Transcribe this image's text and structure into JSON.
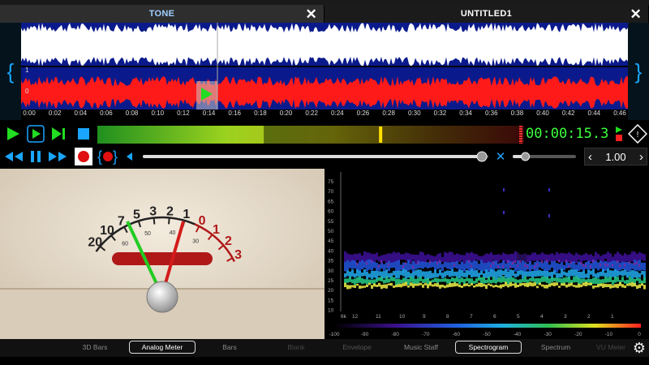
{
  "tabs": [
    {
      "label": "TONE",
      "active": true
    },
    {
      "label": "UNTITLED1",
      "active": false
    }
  ],
  "timeline": [
    "0:00",
    "0:02",
    "0:04",
    "0:06",
    "0:08",
    "0:10",
    "0:12",
    "0:14",
    "0:16",
    "0:18",
    "0:20",
    "0:22",
    "0:24",
    "0:26",
    "0:28",
    "0:30",
    "0:32",
    "0:34",
    "0:36",
    "0:38",
    "0:40",
    "0:42",
    "0:44",
    "0:46"
  ],
  "channel_labels": [
    "1",
    "0"
  ],
  "transport": {
    "time": "00:00:15.3",
    "speed": "1.00",
    "level_fraction": 0.39,
    "volume_fraction": 0.78,
    "pitch_fraction": 0.2
  },
  "meter": {
    "scale_black": [
      "20",
      "10",
      "7",
      "5",
      "3",
      "2",
      "1"
    ],
    "scale_red": [
      "0",
      "1",
      "2",
      "3"
    ],
    "scale_small": [
      "60",
      "50",
      "40",
      "30"
    ]
  },
  "spectrogram": {
    "y_ticks": [
      "75",
      "70",
      "65",
      "60",
      "55",
      "50",
      "45",
      "40",
      "35",
      "30",
      "25",
      "20",
      "15",
      "10"
    ],
    "x_ticks": [
      "12",
      "11",
      "10",
      "9",
      "8",
      "7",
      "6",
      "5",
      "4",
      "3",
      "2",
      "1"
    ],
    "x_prefix": "6k",
    "db_ticks": [
      "-100",
      "-90",
      "-80",
      "-70",
      "-60",
      "-50",
      "-40",
      "-30",
      "-20",
      "-10",
      "0"
    ]
  },
  "view_tabs_left": [
    {
      "label": "3D Bars",
      "selected": false
    },
    {
      "label": "Analog Meter",
      "selected": true
    },
    {
      "label": "Bars",
      "selected": false
    },
    {
      "label": "Blank",
      "selected": false
    }
  ],
  "view_tabs_right": [
    {
      "label": "Envelope",
      "selected": false
    },
    {
      "label": "Music Staff",
      "selected": false
    },
    {
      "label": "Spectrogram",
      "selected": true
    },
    {
      "label": "Spectrum",
      "selected": false
    },
    {
      "label": "VU Meter",
      "selected": false
    }
  ],
  "colors": {
    "wave_bg": "#0a1a8c",
    "wave_top": "#ffffff",
    "wave_bottom": "#ff1a1a",
    "accent": "#1aa6ff",
    "timer": "#3cff3c",
    "play": "#22dd22"
  }
}
